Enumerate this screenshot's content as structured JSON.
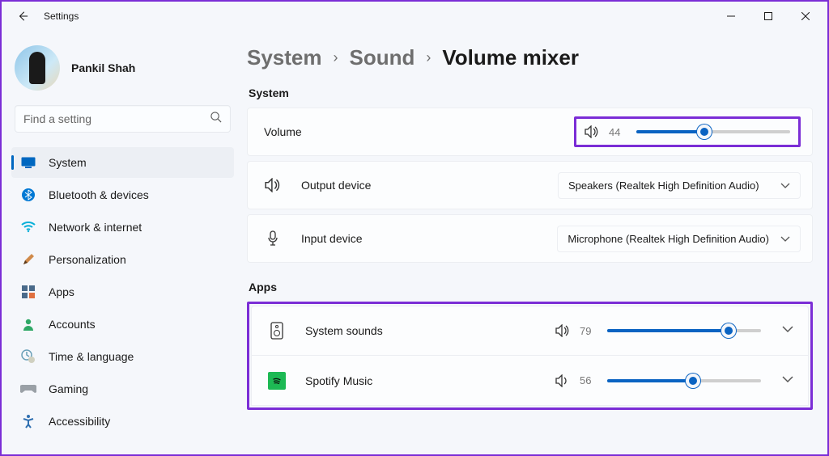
{
  "window": {
    "title": "Settings"
  },
  "user": {
    "name": "Pankil Shah"
  },
  "search": {
    "placeholder": "Find a setting"
  },
  "nav": {
    "items": [
      {
        "label": "System"
      },
      {
        "label": "Bluetooth & devices"
      },
      {
        "label": "Network & internet"
      },
      {
        "label": "Personalization"
      },
      {
        "label": "Apps"
      },
      {
        "label": "Accounts"
      },
      {
        "label": "Time & language"
      },
      {
        "label": "Gaming"
      },
      {
        "label": "Accessibility"
      }
    ]
  },
  "breadcrumb": {
    "level1": "System",
    "level2": "Sound",
    "current": "Volume mixer"
  },
  "sections": {
    "system_label": "System",
    "apps_label": "Apps"
  },
  "system": {
    "volume": {
      "label": "Volume",
      "value": "44",
      "percent": 44
    },
    "output": {
      "label": "Output device",
      "selected": "Speakers (Realtek High Definition Audio)"
    },
    "input": {
      "label": "Input device",
      "selected": "Microphone (Realtek High Definition Audio)"
    }
  },
  "apps": [
    {
      "label": "System sounds",
      "value": "79",
      "percent": 79
    },
    {
      "label": "Spotify Music",
      "value": "56",
      "percent": 56
    }
  ]
}
